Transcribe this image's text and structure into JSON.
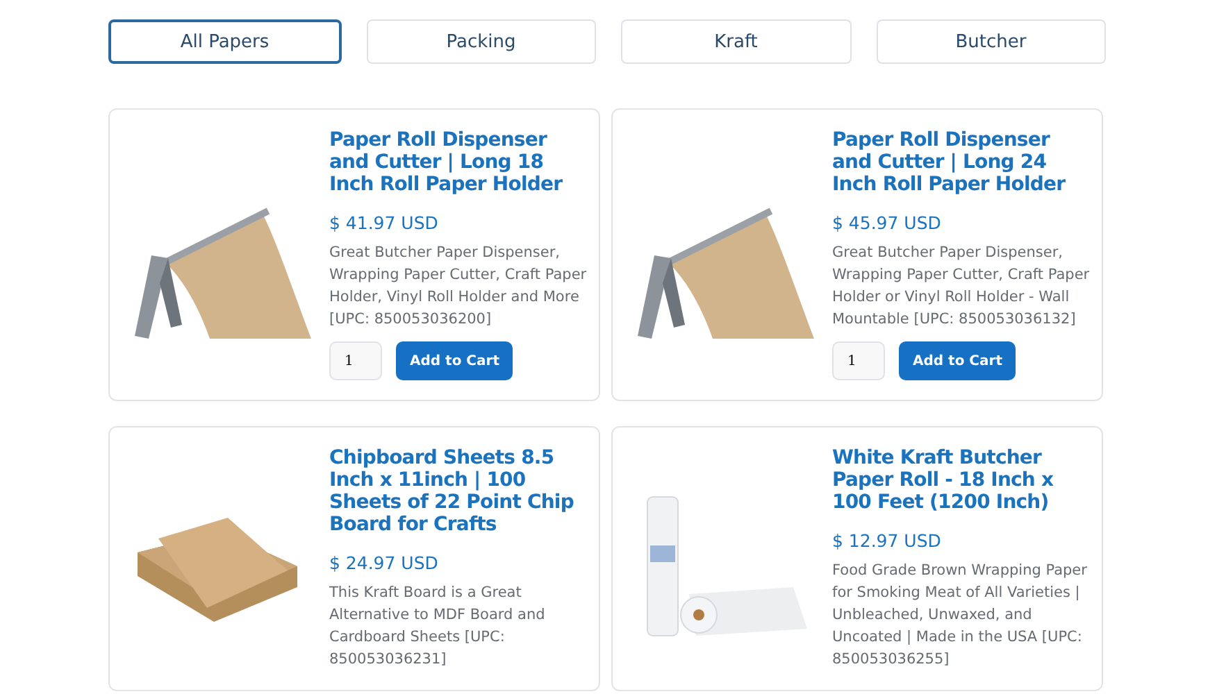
{
  "tabs": [
    {
      "label": "All Papers",
      "selected": true
    },
    {
      "label": "Packing",
      "selected": false
    },
    {
      "label": "Kraft",
      "selected": false
    },
    {
      "label": "Butcher",
      "selected": false
    }
  ],
  "products": [
    {
      "kind": "dispenser",
      "title": "Paper Roll Dispenser and Cutter | Long 18 Inch Roll Paper Holder",
      "price": "$ 41.97 USD",
      "description": "Great Butcher Paper Dispenser, Wrapping Paper Cutter, Craft Paper Holder, Vinyl Roll Holder and More [UPC: 850053036200]",
      "quantity": "1",
      "button": "Add to Cart"
    },
    {
      "kind": "dispenser",
      "title": "Paper Roll Dispenser and Cutter | Long 24 Inch Roll Paper Holder",
      "price": "$ 45.97 USD",
      "description": "Great Butcher Paper Dispenser, Wrapping Paper Cutter, Craft Paper Holder or Vinyl Roll Holder - Wall Mountable [UPC: 850053036132]",
      "quantity": "1",
      "button": "Add to Cart"
    },
    {
      "kind": "sheets",
      "title": "Chipboard Sheets 8.5 Inch x 11inch | 100 Sheets of 22 Point Chip Board for Crafts",
      "price": "$ 24.97 USD",
      "description": "This Kraft Board is a Great Alternative to MDF Board and Cardboard Sheets [UPC: 850053036231]"
    },
    {
      "kind": "roll",
      "title": "White Kraft Butcher Paper Roll - 18 Inch x 100 Feet (1200 Inch)",
      "price": "$ 12.97 USD",
      "description": "Food Grade Brown Wrapping Paper for Smoking Meat of All Varieties | Unbleached, Unwaxed, and Uncoated | Made in the USA [UPC: 850053036255]"
    }
  ]
}
